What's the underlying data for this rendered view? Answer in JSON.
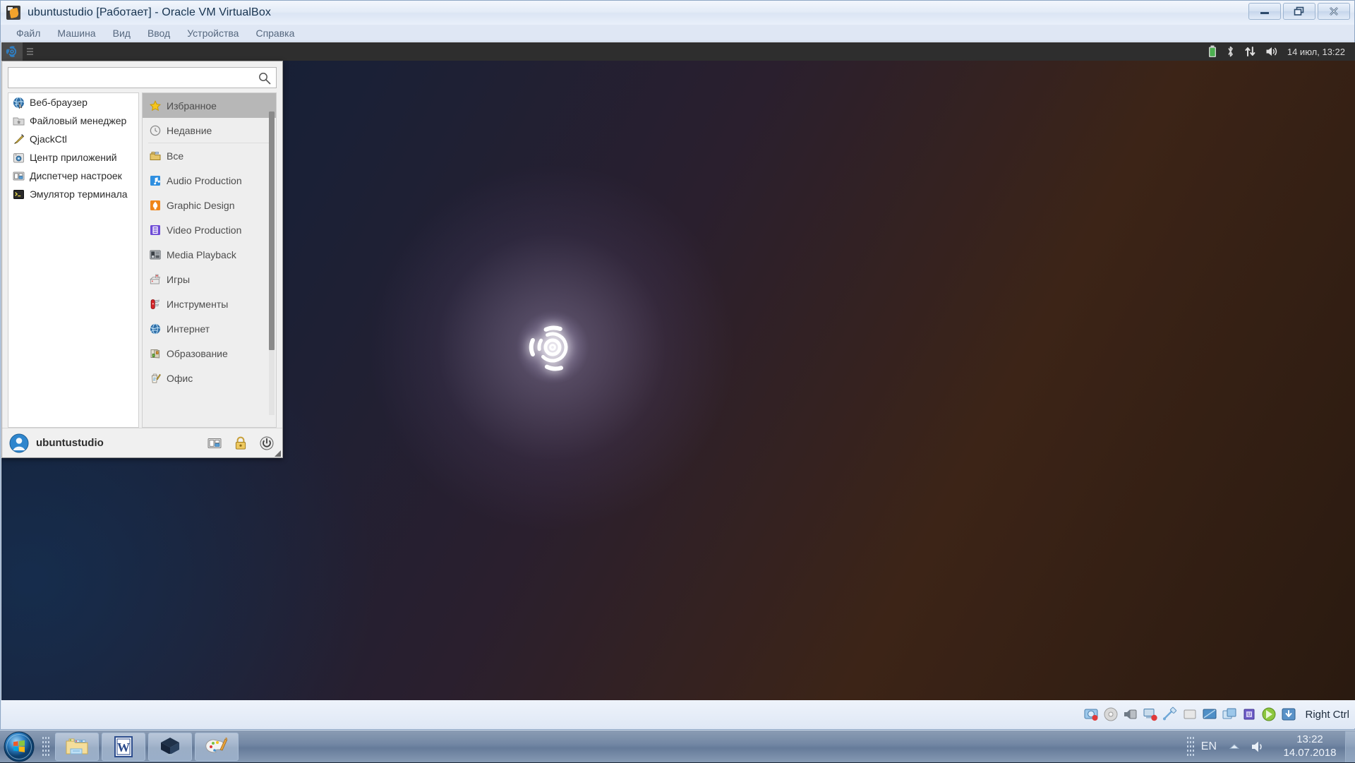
{
  "vbox": {
    "app_icon": "virtualbox-icon",
    "title": "ubuntustudio [Работает] - Oracle VM VirtualBox",
    "menu_items": [
      {
        "label": "Файл",
        "name": "menu-file"
      },
      {
        "label": "Машина",
        "name": "menu-machine"
      },
      {
        "label": "Вид",
        "name": "menu-view"
      },
      {
        "label": "Ввод",
        "name": "menu-input"
      },
      {
        "label": "Устройства",
        "name": "menu-devices"
      },
      {
        "label": "Справка",
        "name": "menu-help"
      }
    ],
    "window_buttons": [
      {
        "name": "minimize-button",
        "icon": "minimize-icon"
      },
      {
        "name": "restore-button",
        "icon": "restore-icon"
      },
      {
        "name": "close-button",
        "icon": "close-icon"
      }
    ],
    "statusbar": {
      "icons": [
        "hard-disk-icon",
        "optical-disk-icon",
        "audio-icon",
        "network-icon",
        "usb-icon",
        "shared-folders-icon",
        "display-icon",
        "video-capture-icon",
        "cpu-icon",
        "guest-additions-icon",
        "mouse-integration-icon"
      ],
      "host_key": "Right Ctrl"
    }
  },
  "xfce_panel": {
    "menu_button_icon": "ubuntustudio-logo-icon",
    "tray_icons": [
      "battery-icon",
      "bluetooth-icon",
      "network-updown-icon",
      "volume-icon"
    ],
    "clock": "14 июл, 13:22"
  },
  "whisker_menu": {
    "search": {
      "value": "",
      "placeholder": "",
      "icon": "search-icon"
    },
    "favorites": [
      {
        "label": "Веб-браузер",
        "icon": "web-browser-icon"
      },
      {
        "label": "Файловый менеджер",
        "icon": "file-manager-icon"
      },
      {
        "label": "QjackCtl",
        "icon": "qjackctl-icon"
      },
      {
        "label": "Центр приложений",
        "icon": "software-center-icon"
      },
      {
        "label": "Диспетчер настроек",
        "icon": "settings-manager-icon"
      },
      {
        "label": "Эмулятор терминала",
        "icon": "terminal-icon"
      }
    ],
    "categories": [
      {
        "label": "Избранное",
        "icon": "star-icon",
        "active": true
      },
      {
        "label": "Недавние",
        "icon": "clock-icon",
        "active": false
      },
      {
        "label": "Все",
        "icon": "all-apps-icon",
        "active": false
      },
      {
        "label": "Audio Production",
        "icon": "audio-note-icon",
        "active": false
      },
      {
        "label": "Graphic Design",
        "icon": "graphic-design-icon",
        "active": false
      },
      {
        "label": "Video Production",
        "icon": "video-film-icon",
        "active": false
      },
      {
        "label": "Media Playback",
        "icon": "media-playback-icon",
        "active": false
      },
      {
        "label": "Игры",
        "icon": "games-icon",
        "active": false
      },
      {
        "label": "Инструменты",
        "icon": "tools-icon",
        "active": false
      },
      {
        "label": "Интернет",
        "icon": "internet-globe-icon",
        "active": false
      },
      {
        "label": "Образование",
        "icon": "education-icon",
        "active": false
      },
      {
        "label": "Офис",
        "icon": "office-icon",
        "active": false
      }
    ],
    "footer": {
      "user": "ubuntustudio",
      "avatar_icon": "user-avatar-icon",
      "actions": [
        {
          "name": "settings-button",
          "icon": "settings-manager-icon"
        },
        {
          "name": "lock-screen-button",
          "icon": "lock-icon"
        },
        {
          "name": "shutdown-button",
          "icon": "power-icon"
        }
      ]
    }
  },
  "desktop": {
    "wallpaper_logo": "ubuntustudio-logo"
  },
  "taskbar": {
    "start_button": {
      "name": "start-button",
      "icon": "windows-start-orb-icon"
    },
    "buttons": [
      {
        "name": "taskbar-explorer",
        "icon": "file-explorer-icon"
      },
      {
        "name": "taskbar-word",
        "icon": "microsoft-word-icon"
      },
      {
        "name": "taskbar-virtualbox",
        "icon": "virtualbox-icon"
      },
      {
        "name": "taskbar-paint",
        "icon": "paint-icon"
      }
    ],
    "tray": {
      "language": "EN",
      "arrow_icon": "show-hidden-icons-icon",
      "volume_icon": "volume-icon",
      "time": "13:22",
      "date": "14.07.2018"
    }
  },
  "colors": {
    "accent": "#3584c6",
    "menu_highlight": "#b7b7b7",
    "panel_bg": "#2e2e2e",
    "taskbar_bg": "#768ba8"
  }
}
